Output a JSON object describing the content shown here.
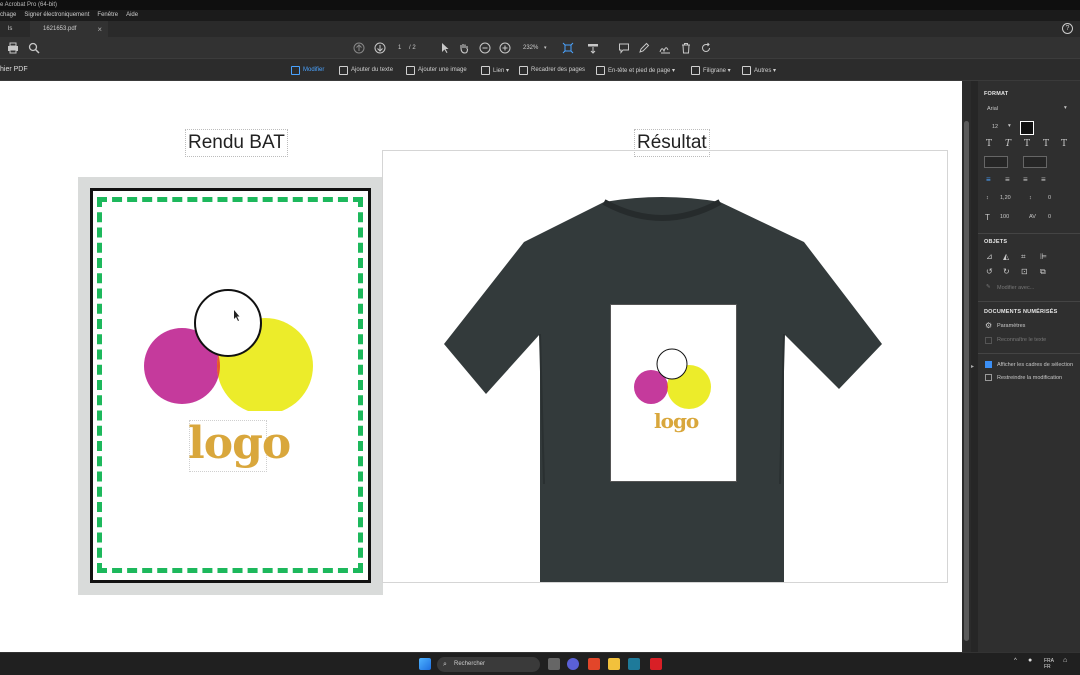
{
  "window": {
    "title": "e Acrobat Pro (64-bit)",
    "menu": [
      "chage",
      "Signer électroniquement",
      "Fenêtre",
      "Aide"
    ]
  },
  "tabs": {
    "home_label": "ls",
    "active_label": "1621653.pdf",
    "close_symbol": "×"
  },
  "toolbar": {
    "page_current": "1",
    "page_total": "/ 2",
    "zoom": "232%"
  },
  "edit_toolbar": {
    "section_label": "hier PDF",
    "tools": [
      {
        "label": "Modifier",
        "icon": "edit-cursor-icon",
        "active": true
      },
      {
        "label": "Ajouter du texte",
        "icon": "add-text-icon"
      },
      {
        "label": "Ajouter une image",
        "icon": "add-image-icon"
      },
      {
        "label": "Lien ▾",
        "icon": "link-icon"
      },
      {
        "label": "Recadrer des pages",
        "icon": "crop-icon"
      },
      {
        "label": "En-tête et pied de page ▾",
        "icon": "header-footer-icon"
      },
      {
        "label": "Filigrane ▾",
        "icon": "watermark-icon"
      },
      {
        "label": "Autres ▾",
        "icon": "more-icon"
      }
    ]
  },
  "document": {
    "left_heading": "Rendu BAT",
    "right_heading": "Résultat",
    "logo_word": "logo"
  },
  "format_panel": {
    "format_title": "FORMAT",
    "font_name": "Arial",
    "font_size": "12",
    "line_spacing": "1,20",
    "para_spacing": "0",
    "scale": "100",
    "tracking": "0",
    "objects_title": "OBJETS",
    "modify_with": "Modifier avec...",
    "scanned_title": "DOCUMENTS NUMÉRISÉS",
    "settings": "Paramètres",
    "recognize_text": "Reconnaître le texte",
    "show_boxes": "Afficher les cadres de sélection",
    "restrict_edit": "Restreindre la modification"
  },
  "taskbar": {
    "search_placeholder": "Rechercher",
    "lang_top": "FRA",
    "lang_bottom": "FR"
  },
  "colors": {
    "accent": "#3b8ff5",
    "dash_green": "#1db85c",
    "magenta": "#c53a9c",
    "yellow": "#ecec2a",
    "overlap": "#e8562a",
    "logo_gold": "#d9a73c",
    "shirt": "#333a3b"
  }
}
